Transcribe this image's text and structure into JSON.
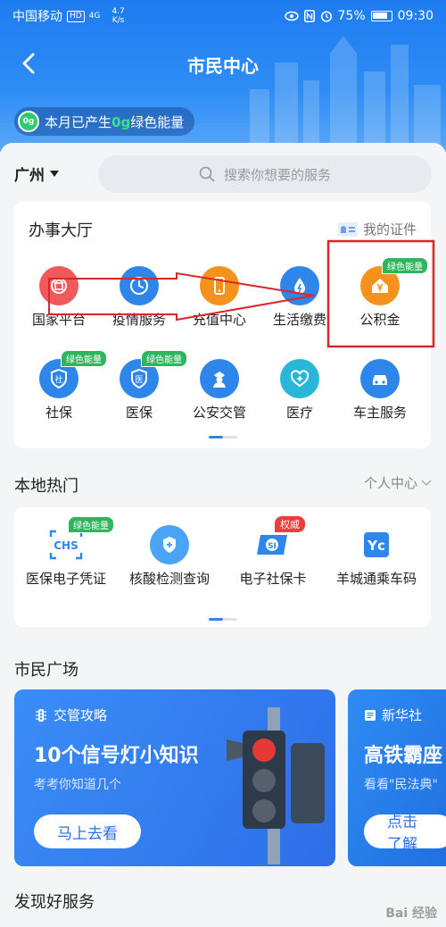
{
  "status_bar": {
    "carrier": "中国移动",
    "hd": "HD",
    "signal": "4G",
    "speed_value": "4.7",
    "speed_unit": "K/s",
    "battery": "75%",
    "time": "09:30"
  },
  "header": {
    "title": "市民中心",
    "energy_icon": "0g",
    "energy_text_pre": "本月已产生",
    "energy_value": "0g",
    "energy_text_post": "绿色能量"
  },
  "location": {
    "city": "广州"
  },
  "search": {
    "placeholder": "搜索你想要的服务"
  },
  "hall": {
    "title": "办事大厅",
    "my_cert": "我的证件",
    "row1": [
      {
        "label": "国家平台",
        "icon": "national-platform-icon",
        "color": "#f05a5a"
      },
      {
        "label": "疫情服务",
        "icon": "epidemic-clock-icon",
        "color": "#2f86ea"
      },
      {
        "label": "充值中心",
        "icon": "phone-recharge-icon",
        "color": "#f5921e"
      },
      {
        "label": "生活缴费",
        "icon": "water-drop-icon",
        "color": "#2f86ea"
      },
      {
        "label": "公积金",
        "icon": "housing-fund-icon",
        "color": "#f5921e",
        "badge": "绿色能量"
      }
    ],
    "row2": [
      {
        "label": "社保",
        "icon": "social-security-icon",
        "color": "#2f86ea",
        "badge": "绿色能量"
      },
      {
        "label": "医保",
        "icon": "medical-insurance-icon",
        "color": "#2f86ea",
        "badge": "绿色能量"
      },
      {
        "label": "公安交管",
        "icon": "police-icon",
        "color": "#2f86ea"
      },
      {
        "label": "医疗",
        "icon": "medical-cross-icon",
        "color": "#29b6d8"
      },
      {
        "label": "车主服务",
        "icon": "car-icon",
        "color": "#2f86ea"
      }
    ]
  },
  "hot": {
    "title": "本地热门",
    "personal": "个人中心",
    "items": [
      {
        "label": "医保电子凭证",
        "icon": "chs-icon",
        "badge": "绿色能量"
      },
      {
        "label": "核酸检测查询",
        "icon": "health-shield-icon"
      },
      {
        "label": "电子社保卡",
        "icon": "social-card-icon",
        "badge": "权威"
      },
      {
        "label": "羊城通乘车码",
        "icon": "ride-code-icon"
      }
    ]
  },
  "plaza": {
    "title": "市民广场",
    "banner1": {
      "tag": "交管攻略",
      "headline": "10个信号灯小知识",
      "sub": "考考你知道几个",
      "button": "马上去看"
    },
    "banner2": {
      "tag": "新华社",
      "headline": "高铁霸座",
      "sub": "看看\"民法典\"",
      "button": "点击了解"
    }
  },
  "discover": {
    "title": "发现好服务"
  },
  "watermark": "Bai 经验",
  "colors": {
    "primary": "#1f7cf0",
    "green": "#2fb55d",
    "red": "#ee3b3b",
    "annotation": "#d9262c"
  }
}
